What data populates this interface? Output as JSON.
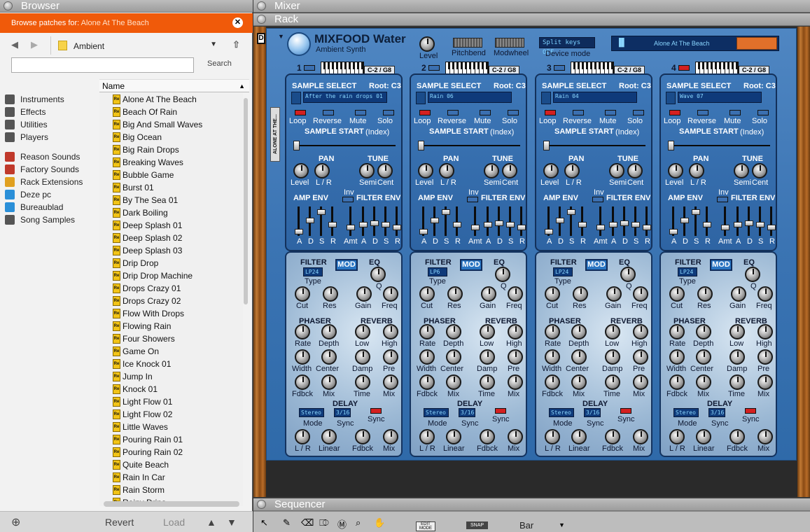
{
  "browser": {
    "title": "Browser",
    "browse_label": "Browse patches for: ",
    "browse_device": "Alone At The Beach",
    "folder": "Ambient",
    "search_label": "Search",
    "search_value": "",
    "column_name": "Name",
    "sidebar": [
      {
        "label": "Instruments",
        "icon": "instruments-icon"
      },
      {
        "label": "Effects",
        "icon": "effects-icon"
      },
      {
        "label": "Utilities",
        "icon": "utilities-icon"
      },
      {
        "label": "Players",
        "icon": "players-icon"
      },
      {
        "label": "Reason Sounds",
        "icon": "reason-sounds-icon"
      },
      {
        "label": "Factory Sounds",
        "icon": "factory-sounds-icon"
      },
      {
        "label": "Rack Extensions",
        "icon": "rack-extensions-icon"
      },
      {
        "label": "Deze pc",
        "icon": "computer-icon"
      },
      {
        "label": "Bureaublad",
        "icon": "desktop-icon"
      },
      {
        "label": "Song Samples",
        "icon": "song-samples-icon"
      }
    ],
    "patches": [
      "Alone At The Beach",
      "Beach Of Rain",
      "Big And Small Waves",
      "Big Ocean",
      "Big Rain Drops",
      "Breaking Waves",
      "Bubble Game",
      "Burst 01",
      "By The Sea 01",
      "Dark Boiling",
      "Deep Splash 01",
      "Deep Splash 02",
      "Deep Splash 03",
      "Drip Drop",
      "Drip Drop Machine",
      "Drops Crazy 01",
      "Drops Crazy 02",
      "Flow With Drops",
      "Flowing Rain",
      "Four Showers",
      "Game On",
      "Ice Knock 01",
      "Jump In",
      "Knock 01",
      "Light Flow 01",
      "Light Flow 02",
      "Little Waves",
      "Pouring Rain 01",
      "Pouring Rain 02",
      "Quite Beach",
      "Rain In Car",
      "Rain Storm",
      "Rainy Drips"
    ],
    "footer": {
      "revert": "Revert",
      "load": "Load"
    }
  },
  "mixer_title": "Mixer",
  "rack_title": "Rack",
  "sequencer_title": "Sequencer",
  "device": {
    "name": "MIXFOOD Water",
    "subtitle": "Ambient Synth",
    "level_label": "Level",
    "pitchbend_label": "Pitchbend",
    "modwheel_label": "Modwheel",
    "device_mode_value": "Split keys OFF",
    "device_mode_label": "Device mode",
    "patch_name": "Alone At The Beach",
    "side_label": "ALONE AT THE..."
  },
  "channels": [
    {
      "num": "1",
      "range": "C-2 / G8",
      "sample": "After the rain drops 01",
      "filter_type": "LP24",
      "delay_mode": "Stereo",
      "delay_sync": "3/16"
    },
    {
      "num": "2",
      "range": "C-2 / G8",
      "sample": "Rain 06",
      "filter_type": "LP6",
      "delay_mode": "Stereo",
      "delay_sync": "3/16"
    },
    {
      "num": "3",
      "range": "C-2 / G8",
      "sample": "Rain 04",
      "filter_type": "LP24",
      "delay_mode": "Stereo",
      "delay_sync": "3/16"
    },
    {
      "num": "4",
      "range": "C-2 / G8",
      "sample": "Wave 07",
      "filter_type": "LP24",
      "delay_mode": "Stereo",
      "delay_sync": "3/16"
    }
  ],
  "labels": {
    "sample_select": "SAMPLE SELECT",
    "root": "Root: C3",
    "loop": "Loop",
    "reverse": "Reverse",
    "mute": "Mute",
    "solo": "Solo",
    "sample_start": "SAMPLE START",
    "index": "(Index)",
    "pan": "PAN",
    "tune": "TUNE",
    "level": "Level",
    "lr": "L / R",
    "semi": "Semi",
    "cent": "Cent",
    "amp_env": "AMP ENV",
    "filter_env": "FILTER ENV",
    "inv": "Inv",
    "amt": "Amt",
    "a": "A",
    "d": "D",
    "s": "S",
    "r": "R",
    "filter": "FILTER",
    "mod": "MOD",
    "eq": "EQ",
    "type": "Type",
    "q": "Q",
    "cut": "Cut",
    "res": "Res",
    "gain": "Gain",
    "freq": "Freq",
    "phaser": "PHASER",
    "reverb": "REVERB",
    "rate": "Rate",
    "depth": "Depth",
    "low": "Low",
    "high": "High",
    "width": "Width",
    "center": "Center",
    "damp": "Damp",
    "pre": "Pre",
    "fdbck": "Fdbck",
    "mix": "Mix",
    "time": "Time",
    "delay": "DELAY",
    "mode": "Mode",
    "sync": "Sync",
    "linear": "Linear"
  },
  "sequencer": {
    "edit_mode": "EDIT MODE",
    "snap": "SNAP",
    "snap_value": "Bar"
  }
}
